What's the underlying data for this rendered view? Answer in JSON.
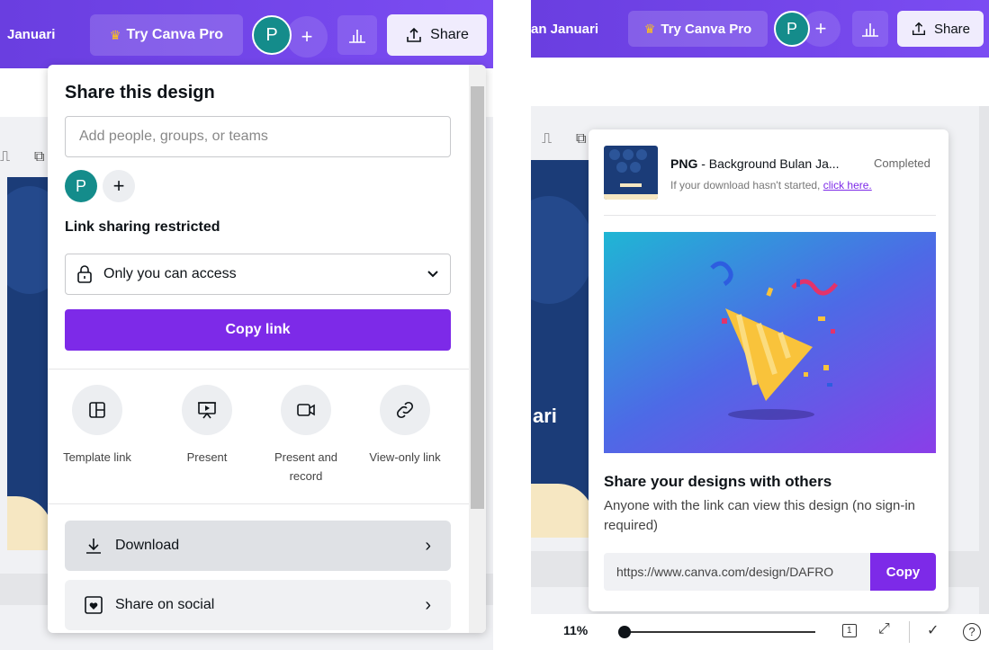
{
  "left": {
    "header": {
      "doc_title": "Januari",
      "try_pro": "Try Canva Pro",
      "avatar_letter": "P",
      "plus": "+",
      "share": "Share"
    },
    "share_panel": {
      "title": "Share this design",
      "add_people_placeholder": "Add people, groups, or teams",
      "collaborator_letter": "P",
      "add_plus": "+",
      "link_sharing_label": "Link sharing restricted",
      "access_option": "Only you can access",
      "copy_link": "Copy link",
      "options": [
        {
          "icon": "template-icon",
          "label": "Template link"
        },
        {
          "icon": "present-icon",
          "label": "Present"
        },
        {
          "icon": "record-icon",
          "label": "Present and record"
        },
        {
          "icon": "link-icon",
          "label": "View-only link"
        }
      ],
      "download": "Download",
      "share_social": "Share on social"
    }
  },
  "right": {
    "header": {
      "doc_title": "an Januari",
      "try_pro": "Try Canva Pro",
      "avatar_letter": "P",
      "plus": "+",
      "share": "Share"
    },
    "canvas_text": "ari",
    "download_popup": {
      "file_type": "PNG",
      "file_name": " - Background Bulan Ja...",
      "status": "Completed",
      "hint_prefix": "If your download hasn't started, ",
      "hint_link": "click here.",
      "heading": "Share your designs with others",
      "description": "Anyone with the link can view this design (no sign-in required)",
      "url": "https://www.canva.com/design/DAFRO",
      "copy": "Copy"
    },
    "footer": {
      "zoom": "11%",
      "page_number": "1"
    }
  },
  "colors": {
    "header_purple": "#7b4cf2",
    "accent_purple": "#7d2ae8",
    "avatar_teal": "#148c8b",
    "design_navy": "#1b3c78"
  }
}
